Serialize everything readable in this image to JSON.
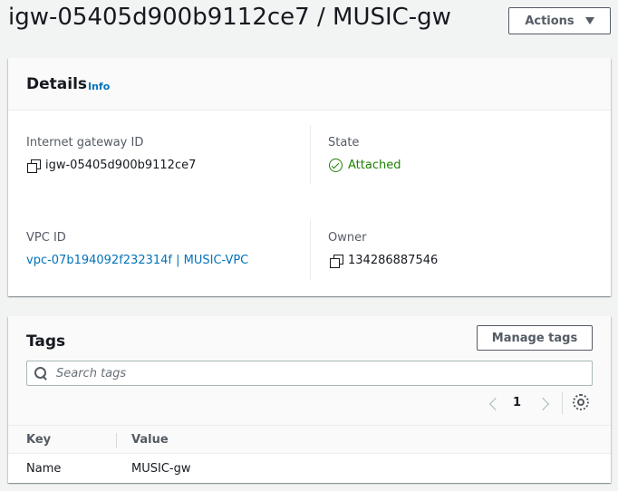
{
  "header": {
    "title": "igw-05405d900b9112ce7 / MUSIC-gw",
    "actions_label": "Actions"
  },
  "details": {
    "title": "Details",
    "info_label": "Info",
    "fields": {
      "igw_id": {
        "label": "Internet gateway ID",
        "value": "igw-05405d900b9112ce7"
      },
      "state": {
        "label": "State",
        "value": "Attached",
        "status_color": "#1d8102"
      },
      "vpc_id": {
        "label": "VPC ID",
        "value": "vpc-07b194092f232314f | MUSIC-VPC"
      },
      "owner": {
        "label": "Owner",
        "value": "134286887546"
      }
    }
  },
  "tags": {
    "title": "Tags",
    "manage_label": "Manage tags",
    "search_placeholder": "Search tags",
    "pagination": {
      "current_page": "1"
    },
    "columns": [
      "Key",
      "Value"
    ],
    "rows": [
      {
        "key": "Name",
        "value": "MUSIC-gw"
      }
    ]
  },
  "colors": {
    "link": "#0073bb",
    "success": "#1d8102",
    "background": "#f2f3f3"
  }
}
